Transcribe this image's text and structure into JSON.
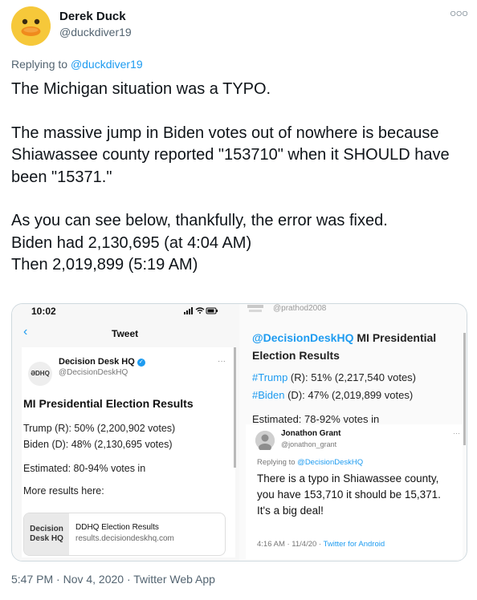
{
  "author": {
    "name": "Derek Duck",
    "handle": "@duckdiver19",
    "more_icon": "ellipsis-icon"
  },
  "reply_context": {
    "prefix": "Replying to ",
    "target": "@duckdiver19"
  },
  "tweet": {
    "text": "The Michigan situation was a TYPO.\n\nThe massive jump in Biden votes out of nowhere is because Shiawassee county reported \"153710\" when it SHOULD have been \"15371.\"\n\nAs you can see below, thankfully, the error was fixed.\nBiden had 2,130,695 (at 4:04 AM)\nThen 2,019,899 (5:19 AM)"
  },
  "media": {
    "left": {
      "status_time": "10:02",
      "nav_title": "Tweet",
      "account_name": "Decision Desk HQ",
      "account_handle": "@DecisionDeskHQ",
      "logo_text": "ƏDHQ",
      "heading": "MI Presidential Election Results",
      "trump_line": "Trump (R): 50% (2,200,902 votes)",
      "biden_line": "Biden (D): 48% (2,130,695 votes)",
      "estimated": "Estimated: 80-94% votes in",
      "more": "More results here:",
      "link_thumb": "Decision Desk HQ",
      "link_title": "DDHQ Election Results",
      "link_url": "results.decisiondeskhq.com"
    },
    "right": {
      "top_handle": "@prathod2008",
      "title_tag": "@DecisionDeskHQ",
      "title_rest": " MI Presidential",
      "title_line2": "Election Results",
      "trump_tag": "#Trump",
      "trump_rest": " (R): 51% (2,217,540 votes)",
      "biden_tag": "#Biden",
      "biden_rest": " (D): 47% (2,019,899 votes)",
      "estimated": "Estimated: 78-92% votes in",
      "reply_name": "Jonathon Grant",
      "reply_handle": "@jonathon_grant",
      "reply_prefix": "Replying to ",
      "reply_target": "@DecisionDeskHQ",
      "reply_text": "There is a typo in Shiawassee county,\nyou have 153,710 it should be 15,371.\nIt's a big deal!",
      "reply_meta_prefix": "4:16 AM · 11/4/20 · ",
      "reply_meta_source": "Twitter for Android"
    }
  },
  "footer": {
    "timestamp": "5:47 PM · Nov 4, 2020 · Twitter Web App"
  }
}
